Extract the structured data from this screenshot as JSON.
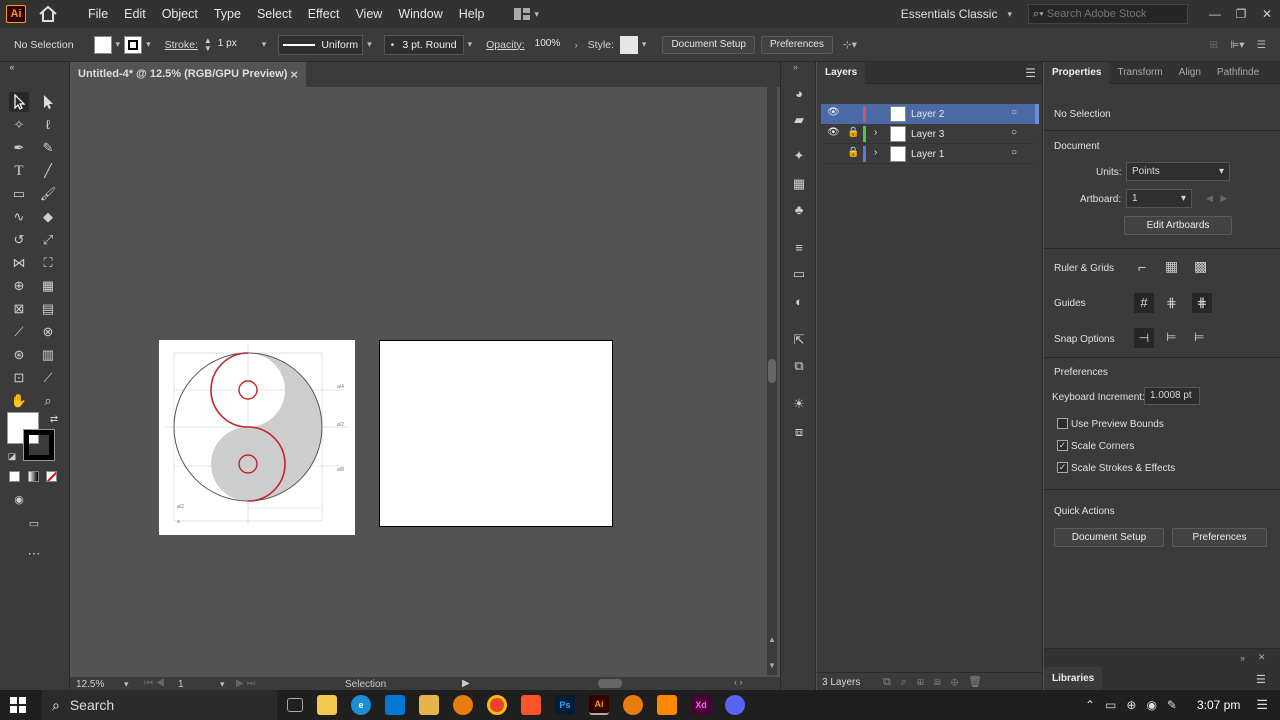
{
  "app": {
    "logo": "Ai",
    "workspace": "Essentials Classic",
    "search_placeholder": "Search Adobe Stock"
  },
  "menu": [
    "File",
    "Edit",
    "Object",
    "Type",
    "Select",
    "Effect",
    "View",
    "Window",
    "Help"
  ],
  "control": {
    "selection": "No Selection",
    "stroke_label": "Stroke:",
    "stroke_value": "1 px",
    "profile": "Uniform",
    "brush": "3 pt. Round",
    "opacity_label": "Opacity:",
    "opacity_value": "100%",
    "style_label": "Style:",
    "doc_setup": "Document Setup",
    "preferences": "Preferences"
  },
  "document": {
    "tab_title": "Untitled-4* @ 12.5% (RGB/GPU Preview)",
    "close": "×"
  },
  "status": {
    "zoom": "12.5%",
    "artboard": "1",
    "tool": "Selection"
  },
  "layers": {
    "tab": "Layers",
    "items": [
      {
        "name": "Layer 2",
        "color": "#e05252"
      },
      {
        "name": "Layer 3",
        "color": "#52c452"
      },
      {
        "name": "Layer 1",
        "color": "#5a78e0"
      }
    ],
    "count": "3 Layers"
  },
  "properties": {
    "tabs": [
      "Properties",
      "Transform",
      "Align",
      "Pathfinde"
    ],
    "selection": "No Selection",
    "document_heading": "Document",
    "units_label": "Units:",
    "units_value": "Points",
    "artboard_label": "Artboard:",
    "artboard_value": "1",
    "edit_artboards": "Edit Artboards",
    "ruler_grids": "Ruler & Grids",
    "guides": "Guides",
    "snap_options": "Snap Options",
    "preferences_heading": "Preferences",
    "keyboard_increment_label": "Keyboard Increment:",
    "keyboard_increment_value": "1.0008 pt",
    "use_preview_bounds": "Use Preview Bounds",
    "scale_corners": "Scale Corners",
    "scale_strokes": "Scale Strokes & Effects",
    "quick_actions": "Quick Actions",
    "doc_setup": "Document Setup",
    "preferences_btn": "Preferences",
    "libraries": "Libraries"
  },
  "artwork_labels": {
    "a": "a/4",
    "b": "a/2",
    "c": "a/8",
    "d": "a/2",
    "e": "a"
  },
  "taskbar": {
    "search": "Search",
    "time": "3:07 pm"
  },
  "colors": {
    "accent": "#4b6aa5",
    "ai_orange": "#ff9a00",
    "yinyang_red": "#c0282d"
  }
}
